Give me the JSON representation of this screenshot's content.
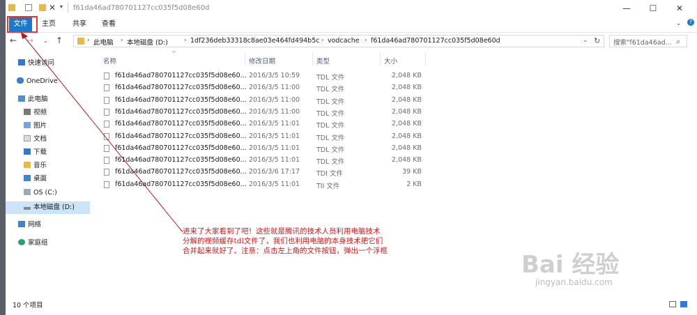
{
  "window": {
    "title": "f61da46ad780701127cc035f5d08e60d",
    "controls": {
      "minimize": "—",
      "maximize": "☐",
      "close": "✕"
    }
  },
  "ribbon": {
    "tabs": [
      "文件",
      "主页",
      "共享",
      "查看"
    ]
  },
  "address": {
    "crumbs": [
      "此电脑",
      "本地磁盘 (D:)",
      "1df236deb33318c8ae03e464fd494b5c",
      "vodcache",
      "f61da46ad780701127cc035f5d08e60d"
    ]
  },
  "search": {
    "placeholder": "搜索\"f61da46ad..."
  },
  "nav": {
    "quick_access": "快速访问",
    "onedrive": "OneDrive",
    "this_pc": "此电脑",
    "videos": "视频",
    "pictures": "图片",
    "documents": "文档",
    "downloads": "下载",
    "music": "音乐",
    "desktop": "桌面",
    "os_c": "OS (C:)",
    "local_d": "本地磁盘 (D:)",
    "network": "网络",
    "homegroup": "家庭组"
  },
  "columns": {
    "name": "名称",
    "date": "修改日期",
    "type": "类型",
    "size": "大小"
  },
  "files": [
    {
      "name": "f61da46ad780701127cc035f5d08e60...",
      "date": "2016/3/5 10:59",
      "type": "TDL 文件",
      "size": "2,048 KB"
    },
    {
      "name": "f61da46ad780701127cc035f5d08e60...",
      "date": "2016/3/5 11:00",
      "type": "TDL 文件",
      "size": "2,048 KB"
    },
    {
      "name": "f61da46ad780701127cc035f5d08e60...",
      "date": "2016/3/5 11:00",
      "type": "TDL 文件",
      "size": "2,048 KB"
    },
    {
      "name": "f61da46ad780701127cc035f5d08e60...",
      "date": "2016/3/5 11:00",
      "type": "TDL 文件",
      "size": "2,048 KB"
    },
    {
      "name": "f61da46ad780701127cc035f5d08e60...",
      "date": "2016/3/5 11:01",
      "type": "TDL 文件",
      "size": "2,048 KB"
    },
    {
      "name": "f61da46ad780701127cc035f5d08e60...",
      "date": "2016/3/5 11:01",
      "type": "TDL 文件",
      "size": "2,048 KB"
    },
    {
      "name": "f61da46ad780701127cc035f5d08e60...",
      "date": "2016/3/5 11:01",
      "type": "TDL 文件",
      "size": "2,048 KB"
    },
    {
      "name": "f61da46ad780701127cc035f5d08e60...",
      "date": "2016/3/5 11:01",
      "type": "TDL 文件",
      "size": "2,048 KB"
    },
    {
      "name": "f61da46ad780701127cc035f5d08e60...",
      "date": "2016/3/6 17:17",
      "type": "TDI 文件",
      "size": "39 KB"
    },
    {
      "name": "f61da46ad780701127cc035f5d08e60...",
      "date": "2016/3/5 11:01",
      "type": "TII 文件",
      "size": "2 KB"
    }
  ],
  "annotation": {
    "line1": "进来了大家看到了吧！这些就是腾讯的技术人员利用电脑技术",
    "line2": "分解的视频缓存tdl文件了，我们也利用电脑的本身技术把它们",
    "line3": "合并起来就好了。注意：点击左上角的文件按钮，弹出一个浮框"
  },
  "status": {
    "item_count": "10 个项目"
  },
  "watermark": {
    "brand": "Bai 经验",
    "url": "jingyan.baidu.com"
  },
  "colors": {
    "accent": "#1979ca",
    "annotation": "#d01818",
    "highlight_box": "#e33333"
  }
}
